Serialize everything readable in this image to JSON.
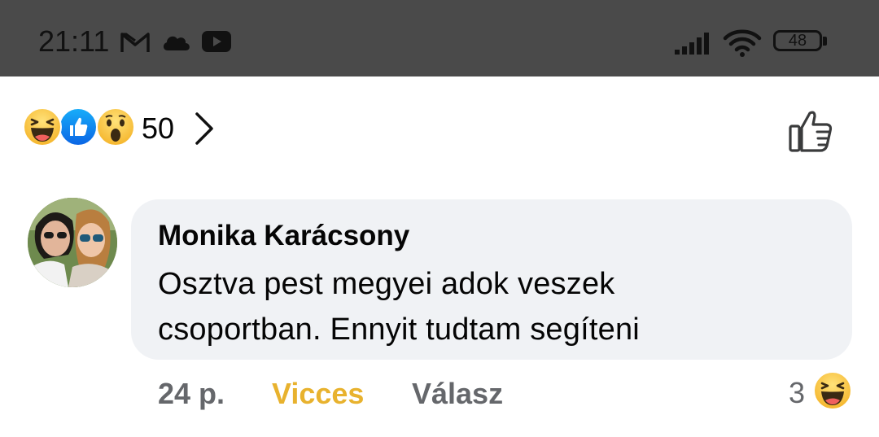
{
  "status_bar": {
    "time": "21:11",
    "battery": "48",
    "icons": [
      "gmail-icon",
      "cloud-icon",
      "youtube-icon",
      "signal-icon",
      "wifi-icon",
      "battery-icon"
    ]
  },
  "reactions": {
    "emojis": [
      "haha",
      "like",
      "wow"
    ],
    "count": "50"
  },
  "comment": {
    "author": "Monika Karácsony",
    "text_line1": "Osztva pest megyei adok veszek",
    "text_line2": "csoportban. Ennyit tudtam segíteni",
    "time": "24 p.",
    "reaction_label": "Vicces",
    "reply_label": "Válasz",
    "reaction_count": "3"
  },
  "colors": {
    "status_bg": "#4a4a4a",
    "bubble_bg": "#f0f2f5",
    "funny": "#e8b22e",
    "meta": "#65676b",
    "like_blue": "#1b74e4"
  }
}
